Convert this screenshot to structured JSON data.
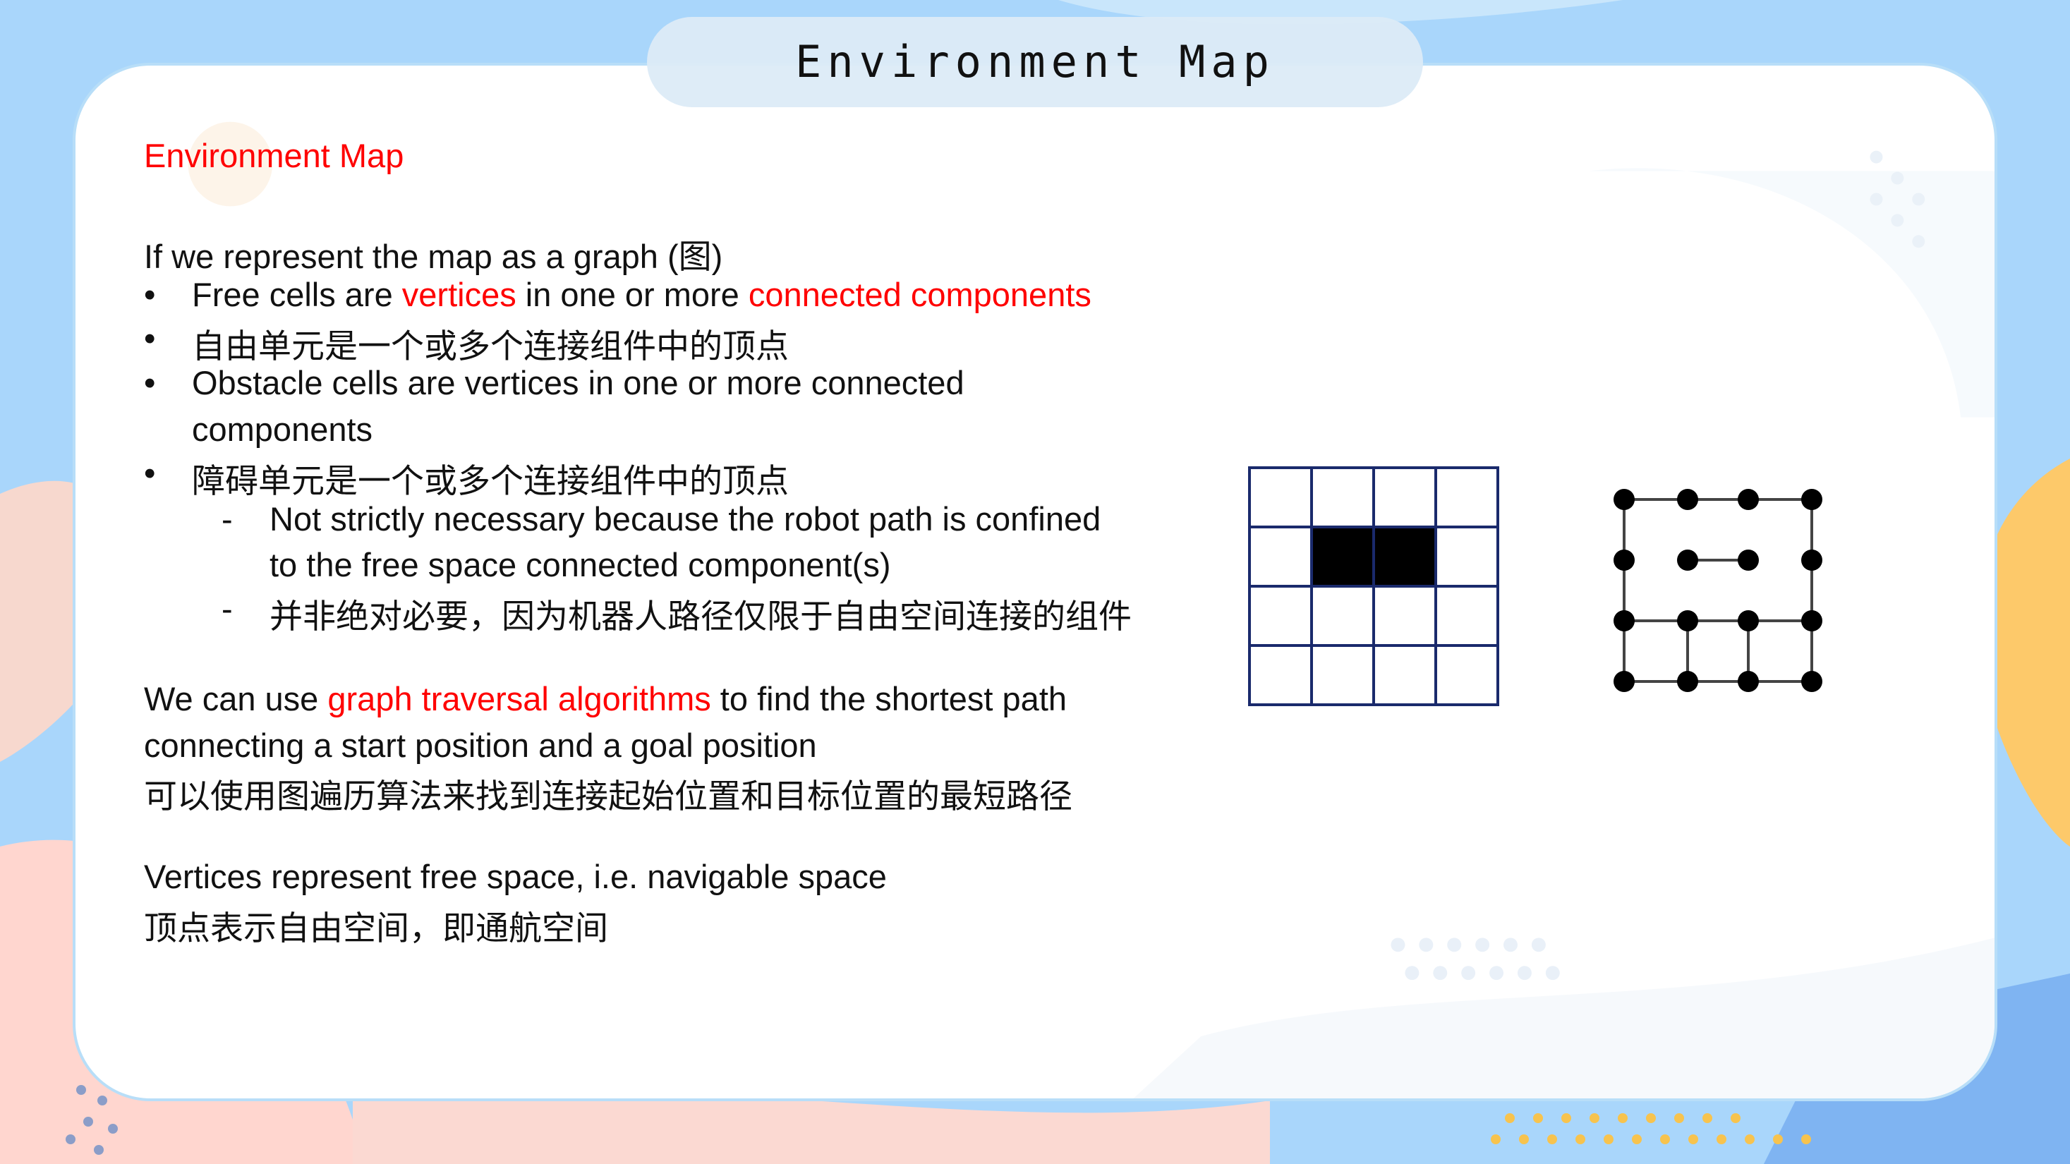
{
  "slide_title": "Environment Map",
  "heading": "Environment Map",
  "intro": "If we represent the map as a graph (图)",
  "bullets": {
    "b1": {
      "p1": "Free cells are ",
      "p2": "vertices",
      "p3": " in one or more ",
      "p4": "connected components"
    },
    "b2": "自由单元是一个或多个连接组件中的顶点",
    "b3_line1": "Obstacle cells are vertices in one or more connected",
    "b3_line2": "components",
    "b4": "障碍单元是一个或多个连接组件中的顶点",
    "sub1_line1": "Not strictly necessary because the robot path is confined",
    "sub1_line2": "to the free space connected component(s)",
    "sub2": "并非绝对必要，因为机器人路径仅限于自由空间连接的组件"
  },
  "bullet_char": "•",
  "dash_char": "-",
  "traversal": {
    "p1": "We can use ",
    "p2": "graph traversal algorithms",
    "p3": " to find the shortest path",
    "line2": "connecting a start position and a goal position",
    "zh": "可以使用图遍历算法来找到连接起始位置和目标位置的最短路径"
  },
  "vertices": {
    "en": "Vertices represent free space, i.e. navigable space",
    "zh": "顶点表示自由空间，即通航空间"
  },
  "grid_figure": {
    "rows": 4,
    "cols": 4,
    "obstacle_cells": [
      [
        1,
        1
      ],
      [
        1,
        2
      ]
    ],
    "line_color": "#1a2a6c",
    "fill_color": "#000000"
  },
  "graph_figure": {
    "node_color": "#000000",
    "edge_color": "#444444"
  },
  "colors": {
    "accent": "#ff0000",
    "text": "#111111"
  }
}
